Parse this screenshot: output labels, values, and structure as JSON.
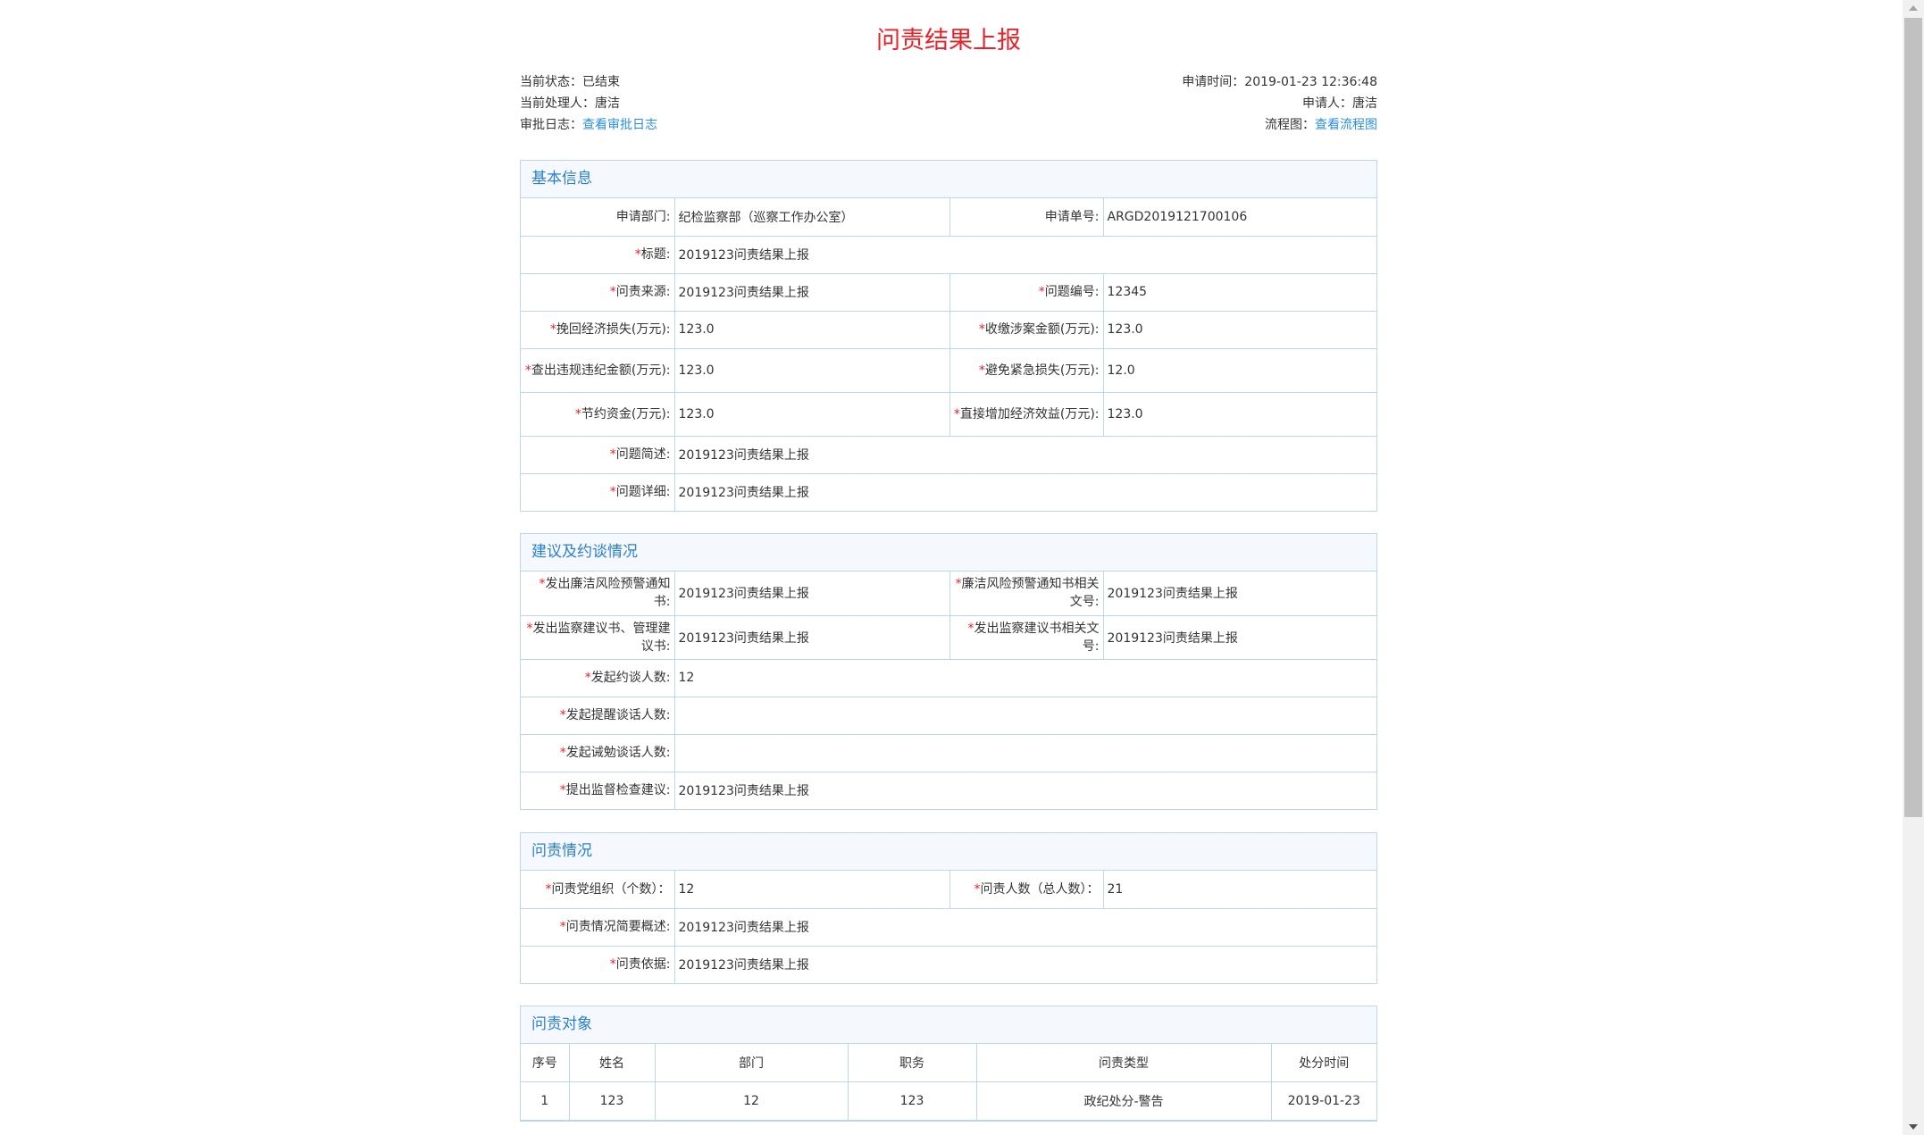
{
  "title": "问责结果上报",
  "meta": {
    "status_label": "当前状态：",
    "status_value": "已结束",
    "handler_label": "当前处理人：",
    "handler_value": "唐洁",
    "log_label": "审批日志：",
    "log_link": "查看审批日志",
    "apply_time_label": "申请时间：",
    "apply_time_value": "2019-01-23 12:36:48",
    "applicant_label": "申请人：",
    "applicant_value": "唐洁",
    "flow_label": "流程图：",
    "flow_link": "查看流程图"
  },
  "basic": {
    "heading": "基本信息",
    "dept_label": "申请部门:",
    "dept_value": "纪检监察部（巡察工作办公室）",
    "no_label": "申请单号:",
    "no_value": "ARGD2019121700106",
    "subject_label": "标题:",
    "subject_value": "2019123问责结果上报",
    "source_label": "问责来源:",
    "source_value": "2019123问责结果上报",
    "issue_no_label": "问题编号:",
    "issue_no_value": "12345",
    "recover_label": "挽回经济损失(万元):",
    "recover_value": "123.0",
    "collect_label": "收缴涉案金额(万元):",
    "collect_value": "123.0",
    "violation_label": "查出违规违纪金额(万元):",
    "violation_value": "123.0",
    "avoid_label": "避免紧急损失(万元):",
    "avoid_value": "12.0",
    "save_label": "节约资金(万元):",
    "save_value": "123.0",
    "benefit_label": "直接增加经济效益(万元):",
    "benefit_value": "123.0",
    "brief_label": "问题简述:",
    "brief_value": "2019123问责结果上报",
    "detail_label": "问题详细:",
    "detail_value": "2019123问责结果上报"
  },
  "suggest": {
    "heading": "建议及约谈情况",
    "warn_notice_label": "发出廉洁风险预警通知书:",
    "warn_notice_value": "2019123问责结果上报",
    "warn_doc_label": "廉洁风险预警通知书相关文号:",
    "warn_doc_value": "2019123问责结果上报",
    "supervise_label": "发出监察建议书、管理建议书:",
    "supervise_value": "2019123问责结果上报",
    "supervise_doc_label": "发出监察建议书相关文号:",
    "supervise_doc_value": "2019123问责结果上报",
    "talk_label": "发起约谈人数:",
    "talk_value": "12",
    "remind_label": "发起提醒谈话人数:",
    "remind_value": "",
    "admonish_label": "发起诫勉谈话人数:",
    "admonish_value": "",
    "inspect_label": "提出监督检查建议:",
    "inspect_value": "2019123问责结果上报"
  },
  "accountability": {
    "heading": "问责情况",
    "org_label": "问责党组织（个数）：",
    "org_value": "12",
    "people_label": "问责人数（总人数）：",
    "people_value": "21",
    "summary_label": "问责情况简要概述:",
    "summary_value": "2019123问责结果上报",
    "basis_label": "问责依据:",
    "basis_value": "2019123问责结果上报"
  },
  "targets": {
    "heading": "问责对象",
    "columns": [
      "序号",
      "姓名",
      "部门",
      "职务",
      "问责类型",
      "处分时间"
    ],
    "rows": [
      [
        "1",
        "123",
        "12",
        "123",
        "政纪处分-警告",
        "2019-01-23"
      ]
    ]
  }
}
